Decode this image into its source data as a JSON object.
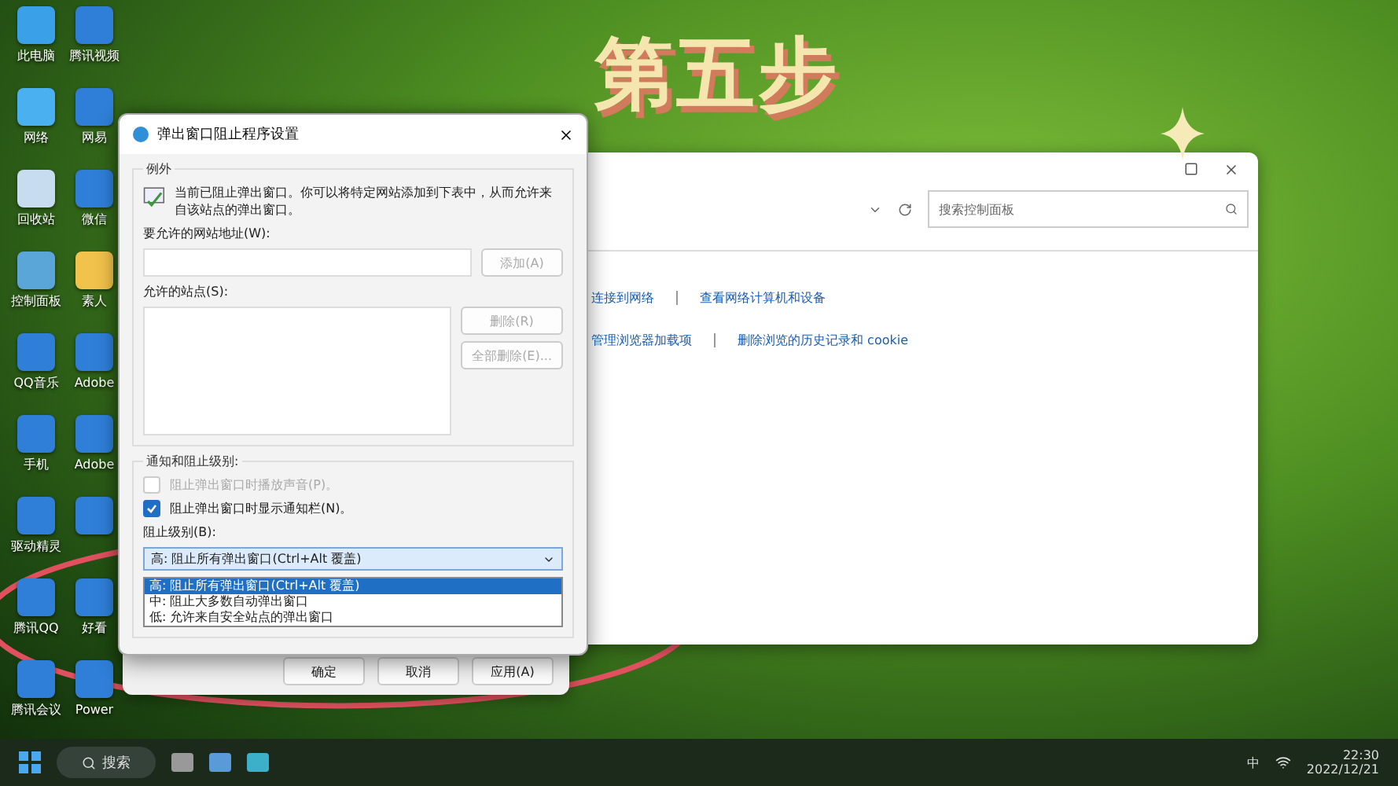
{
  "overlay_title": "第五步",
  "desktop_icons": [
    [
      {
        "label": "此电脑",
        "kind": "monitor"
      },
      {
        "label": "网络",
        "kind": "network"
      },
      {
        "label": "回收站",
        "kind": "bin"
      },
      {
        "label": "控制面板",
        "kind": "panel"
      },
      {
        "label": "QQ音乐",
        "kind": "app"
      },
      {
        "label": "手机",
        "kind": "app"
      },
      {
        "label": "驱动精灵",
        "kind": "app"
      },
      {
        "label": "腾讯QQ",
        "kind": "app"
      },
      {
        "label": "腾讯会议",
        "kind": "app"
      }
    ],
    [
      {
        "label": "腾讯视频",
        "kind": "app"
      },
      {
        "label": "网易",
        "kind": "app"
      },
      {
        "label": "微信",
        "kind": "app"
      },
      {
        "label": "素人",
        "kind": "folder"
      },
      {
        "label": "Adobe",
        "kind": "app"
      },
      {
        "label": "Adobe",
        "kind": "app"
      },
      {
        "kind": "app"
      },
      {
        "label": "好看",
        "kind": "app"
      },
      {
        "label": "Power",
        "kind": "app"
      }
    ]
  ],
  "background_window": {
    "search_placeholder": "搜索控制面板",
    "link_rows": [
      [
        "连接到网络",
        "查看网络计算机和设备"
      ],
      [
        "管理浏览器加载项",
        "删除浏览的历史记录和 cookie"
      ]
    ]
  },
  "internet_options_footer": {
    "buttons": [
      "确定",
      "取消",
      "应用(A)"
    ]
  },
  "popup_dialog": {
    "title": "弹出窗口阻止程序设置",
    "group_label": "例外",
    "description": "当前已阻止弹出窗口。你可以将特定网站添加到下表中，从而允许来自该站点的弹出窗口。",
    "address_label": "要允许的网站地址(W):",
    "add_button": "添加(A)",
    "allowed_label": "允许的站点(S):",
    "side_buttons": [
      {
        "label": "删除(R)",
        "disabled": true
      },
      {
        "label": "全部删除(E)...",
        "disabled": true
      }
    ],
    "notify_label": "通知和阻止级别:",
    "checkboxes": [
      {
        "label": "阻止弹出窗口时播放声音(P)。",
        "checked": false,
        "disabled": true
      },
      {
        "label": "阻止弹出窗口时显示通知栏(N)。",
        "checked": true,
        "disabled": false
      }
    ],
    "level_label": "阻止级别(B):",
    "dropdown_value": "高: 阻止所有弹出窗口(Ctrl+Alt 覆盖)",
    "options": [
      {
        "label": "高: 阻止所有弹出窗口(Ctrl+Alt 覆盖)",
        "selected": true
      },
      {
        "label": "中: 阻止大多数自动弹出窗口",
        "selected": false
      },
      {
        "label": "低: 允许来自安全站点的弹出窗口",
        "selected": false
      }
    ]
  },
  "taskbar": {
    "search": "搜索",
    "ime": "中",
    "time": "22:30",
    "date": "2022/12/21"
  }
}
